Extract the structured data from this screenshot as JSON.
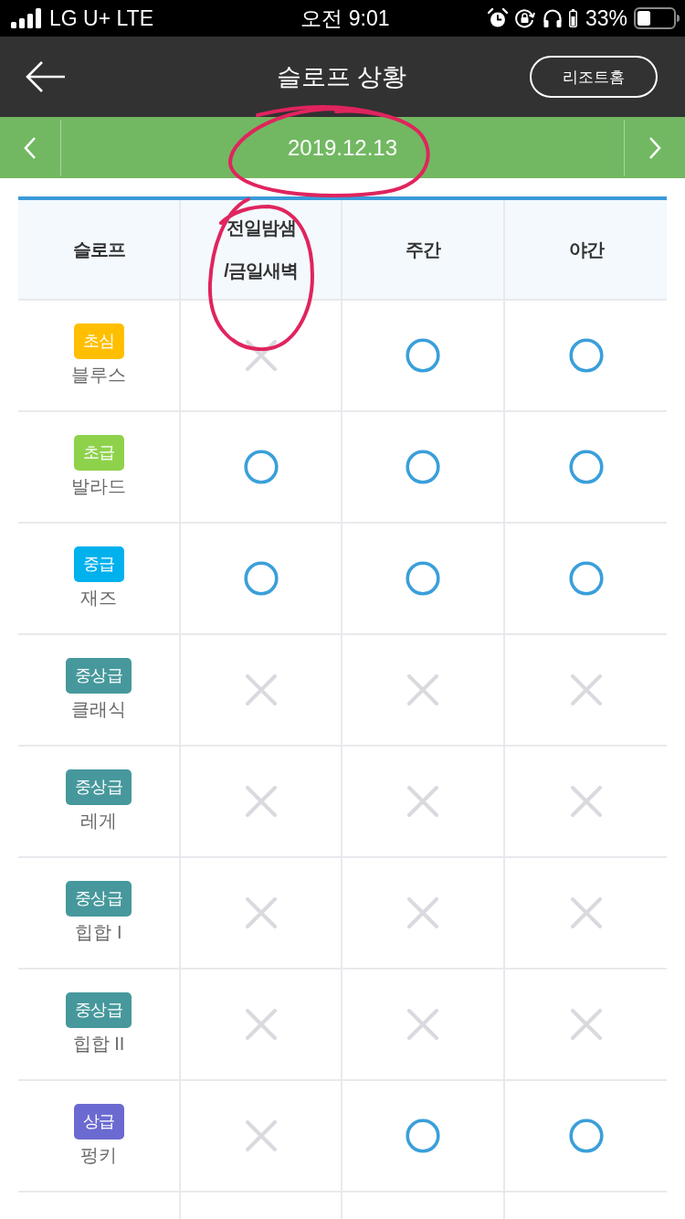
{
  "status_bar": {
    "carrier": "LG U+ LTE",
    "time": "오전 9:01",
    "battery_percent": "33%"
  },
  "header": {
    "title": "슬로프 상황",
    "button": "리조트홈"
  },
  "date_bar": {
    "date": "2019.12.13"
  },
  "table": {
    "columns": [
      {
        "label": "슬로프"
      },
      {
        "label": "전일밤샘\n/금일새벽"
      },
      {
        "label": "주간"
      },
      {
        "label": "야간"
      }
    ],
    "rows": [
      {
        "grade": "초심",
        "color": "#ffbf00",
        "name": "블루스",
        "sessions": [
          {
            "open": false
          },
          {
            "open": true
          },
          {
            "open": true
          }
        ]
      },
      {
        "grade": "초급",
        "color": "#8ed24c",
        "name": "발라드",
        "sessions": [
          {
            "open": true
          },
          {
            "open": true
          },
          {
            "open": true
          }
        ]
      },
      {
        "grade": "중급",
        "color": "#00b1ee",
        "name": "재즈",
        "sessions": [
          {
            "open": true
          },
          {
            "open": true
          },
          {
            "open": true
          }
        ]
      },
      {
        "grade": "중상급",
        "color": "#46989c",
        "name": "클래식",
        "sessions": [
          {
            "open": false
          },
          {
            "open": false
          },
          {
            "open": false
          }
        ]
      },
      {
        "grade": "중상급",
        "color": "#46989c",
        "name": "레게",
        "sessions": [
          {
            "open": false
          },
          {
            "open": false
          },
          {
            "open": false
          }
        ]
      },
      {
        "grade": "중상급",
        "color": "#46989c",
        "name": "힙합 I",
        "sessions": [
          {
            "open": false
          },
          {
            "open": false
          },
          {
            "open": false
          }
        ]
      },
      {
        "grade": "중상급",
        "color": "#46989c",
        "name": "힙합 II",
        "sessions": [
          {
            "open": false
          },
          {
            "open": false
          },
          {
            "open": false
          }
        ]
      },
      {
        "grade": "상급",
        "color": "#6b6ad1",
        "name": "펑키",
        "sessions": [
          {
            "open": false
          },
          {
            "open": true
          },
          {
            "open": true
          }
        ]
      }
    ]
  }
}
